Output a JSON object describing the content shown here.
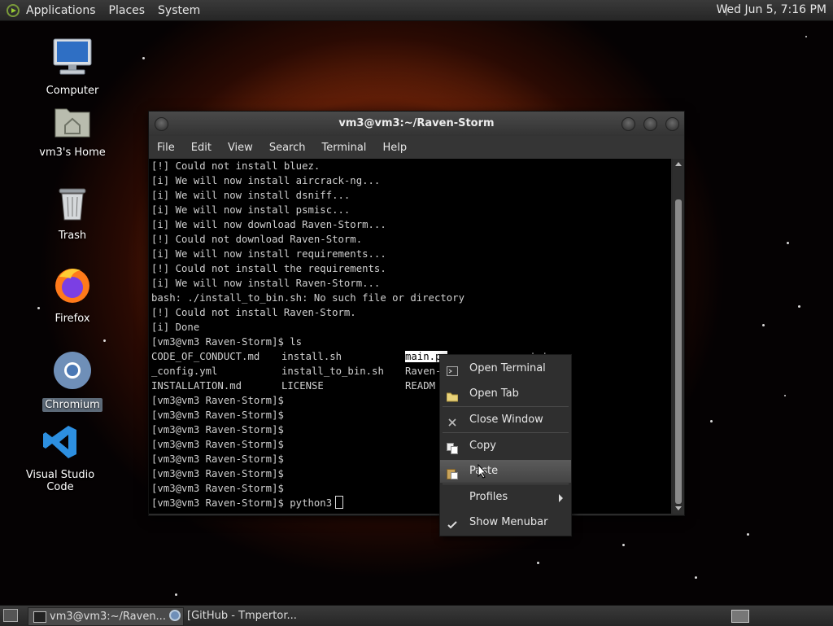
{
  "top_panel": {
    "menus": [
      "Applications",
      "Places",
      "System"
    ],
    "clock": "Wed Jun  5,  7:16 PM"
  },
  "desktop_icons": [
    {
      "label": "Computer",
      "icon": "computer-icon"
    },
    {
      "label": "vm3's Home",
      "icon": "home-folder-icon"
    },
    {
      "label": "Trash",
      "icon": "trash-icon"
    },
    {
      "label": "Firefox",
      "icon": "firefox-icon"
    },
    {
      "label": "Chromium",
      "icon": "chromium-icon"
    },
    {
      "label": "Visual Studio Code",
      "icon": "vscode-icon"
    }
  ],
  "window": {
    "title": "vm3@vm3:~/Raven-Storm",
    "menus": [
      "File",
      "Edit",
      "View",
      "Search",
      "Terminal",
      "Help"
    ]
  },
  "terminal": {
    "lines": [
      "[!] Could not install bluez.",
      "[i] We will now install aircrack-ng...",
      "[i] We will now install dsniff...",
      "[i] We will now install psmisc...",
      "[i] We will now download Raven-Storm...",
      "[!] Could not download Raven-Storm.",
      "[i] We will now install requirements...",
      "[!] Could not install the requirements.",
      "[i] We will now install Raven-Storm...",
      "bash: ./install_to_bin.sh: No such file or directory",
      "[!] Could not install Raven-Storm.",
      "[i] Done",
      "[vm3@vm3 Raven-Storm]$ ls"
    ],
    "ls_rows": [
      [
        "CODE_OF_CONDUCT.md",
        "install.sh",
        "main.py",
        "txt"
      ],
      [
        "_config.yml",
        "install_to_bin.sh",
        "Raven-",
        ""
      ],
      [
        "INSTALLATION.md",
        "LICENSE",
        "READM",
        ""
      ]
    ],
    "prompts": [
      "[vm3@vm3 Raven-Storm]$",
      "[vm3@vm3 Raven-Storm]$",
      "[vm3@vm3 Raven-Storm]$",
      "[vm3@vm3 Raven-Storm]$",
      "[vm3@vm3 Raven-Storm]$",
      "[vm3@vm3 Raven-Storm]$",
      "[vm3@vm3 Raven-Storm]$"
    ],
    "last_prompt": "[vm3@vm3 Raven-Storm]$ python3"
  },
  "context_menu": {
    "items": [
      {
        "label": "Open Terminal",
        "icon": "terminal-icon"
      },
      {
        "label": "Open Tab",
        "icon": "folder-tab-icon"
      },
      {
        "label": "Close Window",
        "icon": "close-icon"
      },
      {
        "label": "Copy",
        "icon": "copy-icon"
      },
      {
        "label": "Paste",
        "icon": "paste-icon"
      },
      {
        "label": "Profiles",
        "icon": "submenu-arrow-icon"
      },
      {
        "label": "Show Menubar",
        "icon": "checkmark-icon"
      }
    ]
  },
  "taskbar": {
    "tasks": [
      {
        "label": "vm3@vm3:~/Raven...",
        "icon": "terminal-icon"
      },
      {
        "label": "[GitHub - Tmpertor...",
        "icon": "chromium-icon"
      }
    ]
  }
}
